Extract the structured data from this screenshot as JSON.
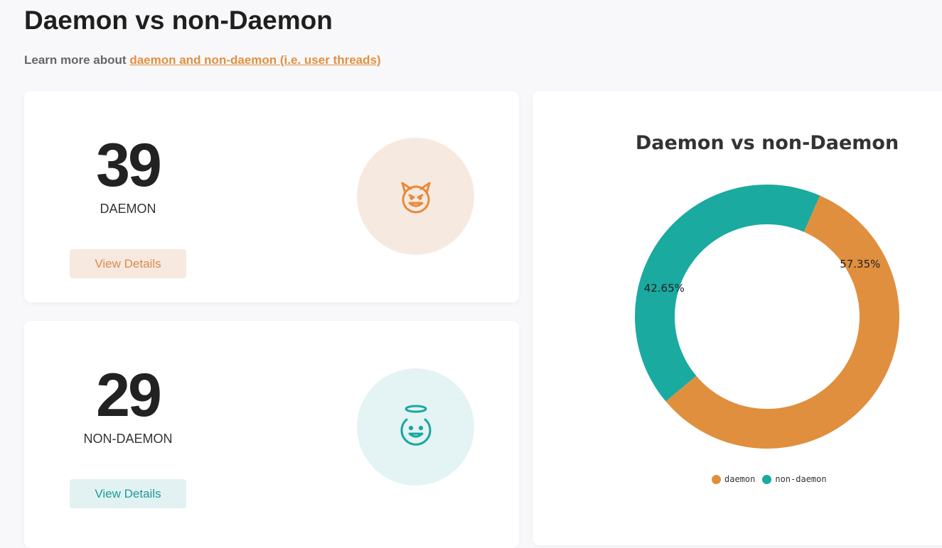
{
  "header": {
    "title": "Daemon vs non-Daemon",
    "learn_prefix": "Learn more about",
    "learn_link": "daemon and non-daemon (i.e. user threads)"
  },
  "daemon_card": {
    "count": "39",
    "label": "DAEMON",
    "button": "View Details",
    "icon": "devil-face-icon"
  },
  "nondaemon_card": {
    "count": "29",
    "label": "NON-DAEMON",
    "button": "View Details",
    "icon": "angel-face-icon"
  },
  "colors": {
    "daemon": "#e08f3e",
    "nondaemon": "#1aaaa0"
  },
  "chart_data": {
    "type": "pie",
    "title": "Daemon vs non-Daemon",
    "donut": true,
    "categories": [
      "daemon",
      "non-daemon"
    ],
    "values": [
      39,
      29
    ],
    "percent_labels": [
      "57.35%",
      "42.65%"
    ],
    "legend_position": "bottom"
  }
}
